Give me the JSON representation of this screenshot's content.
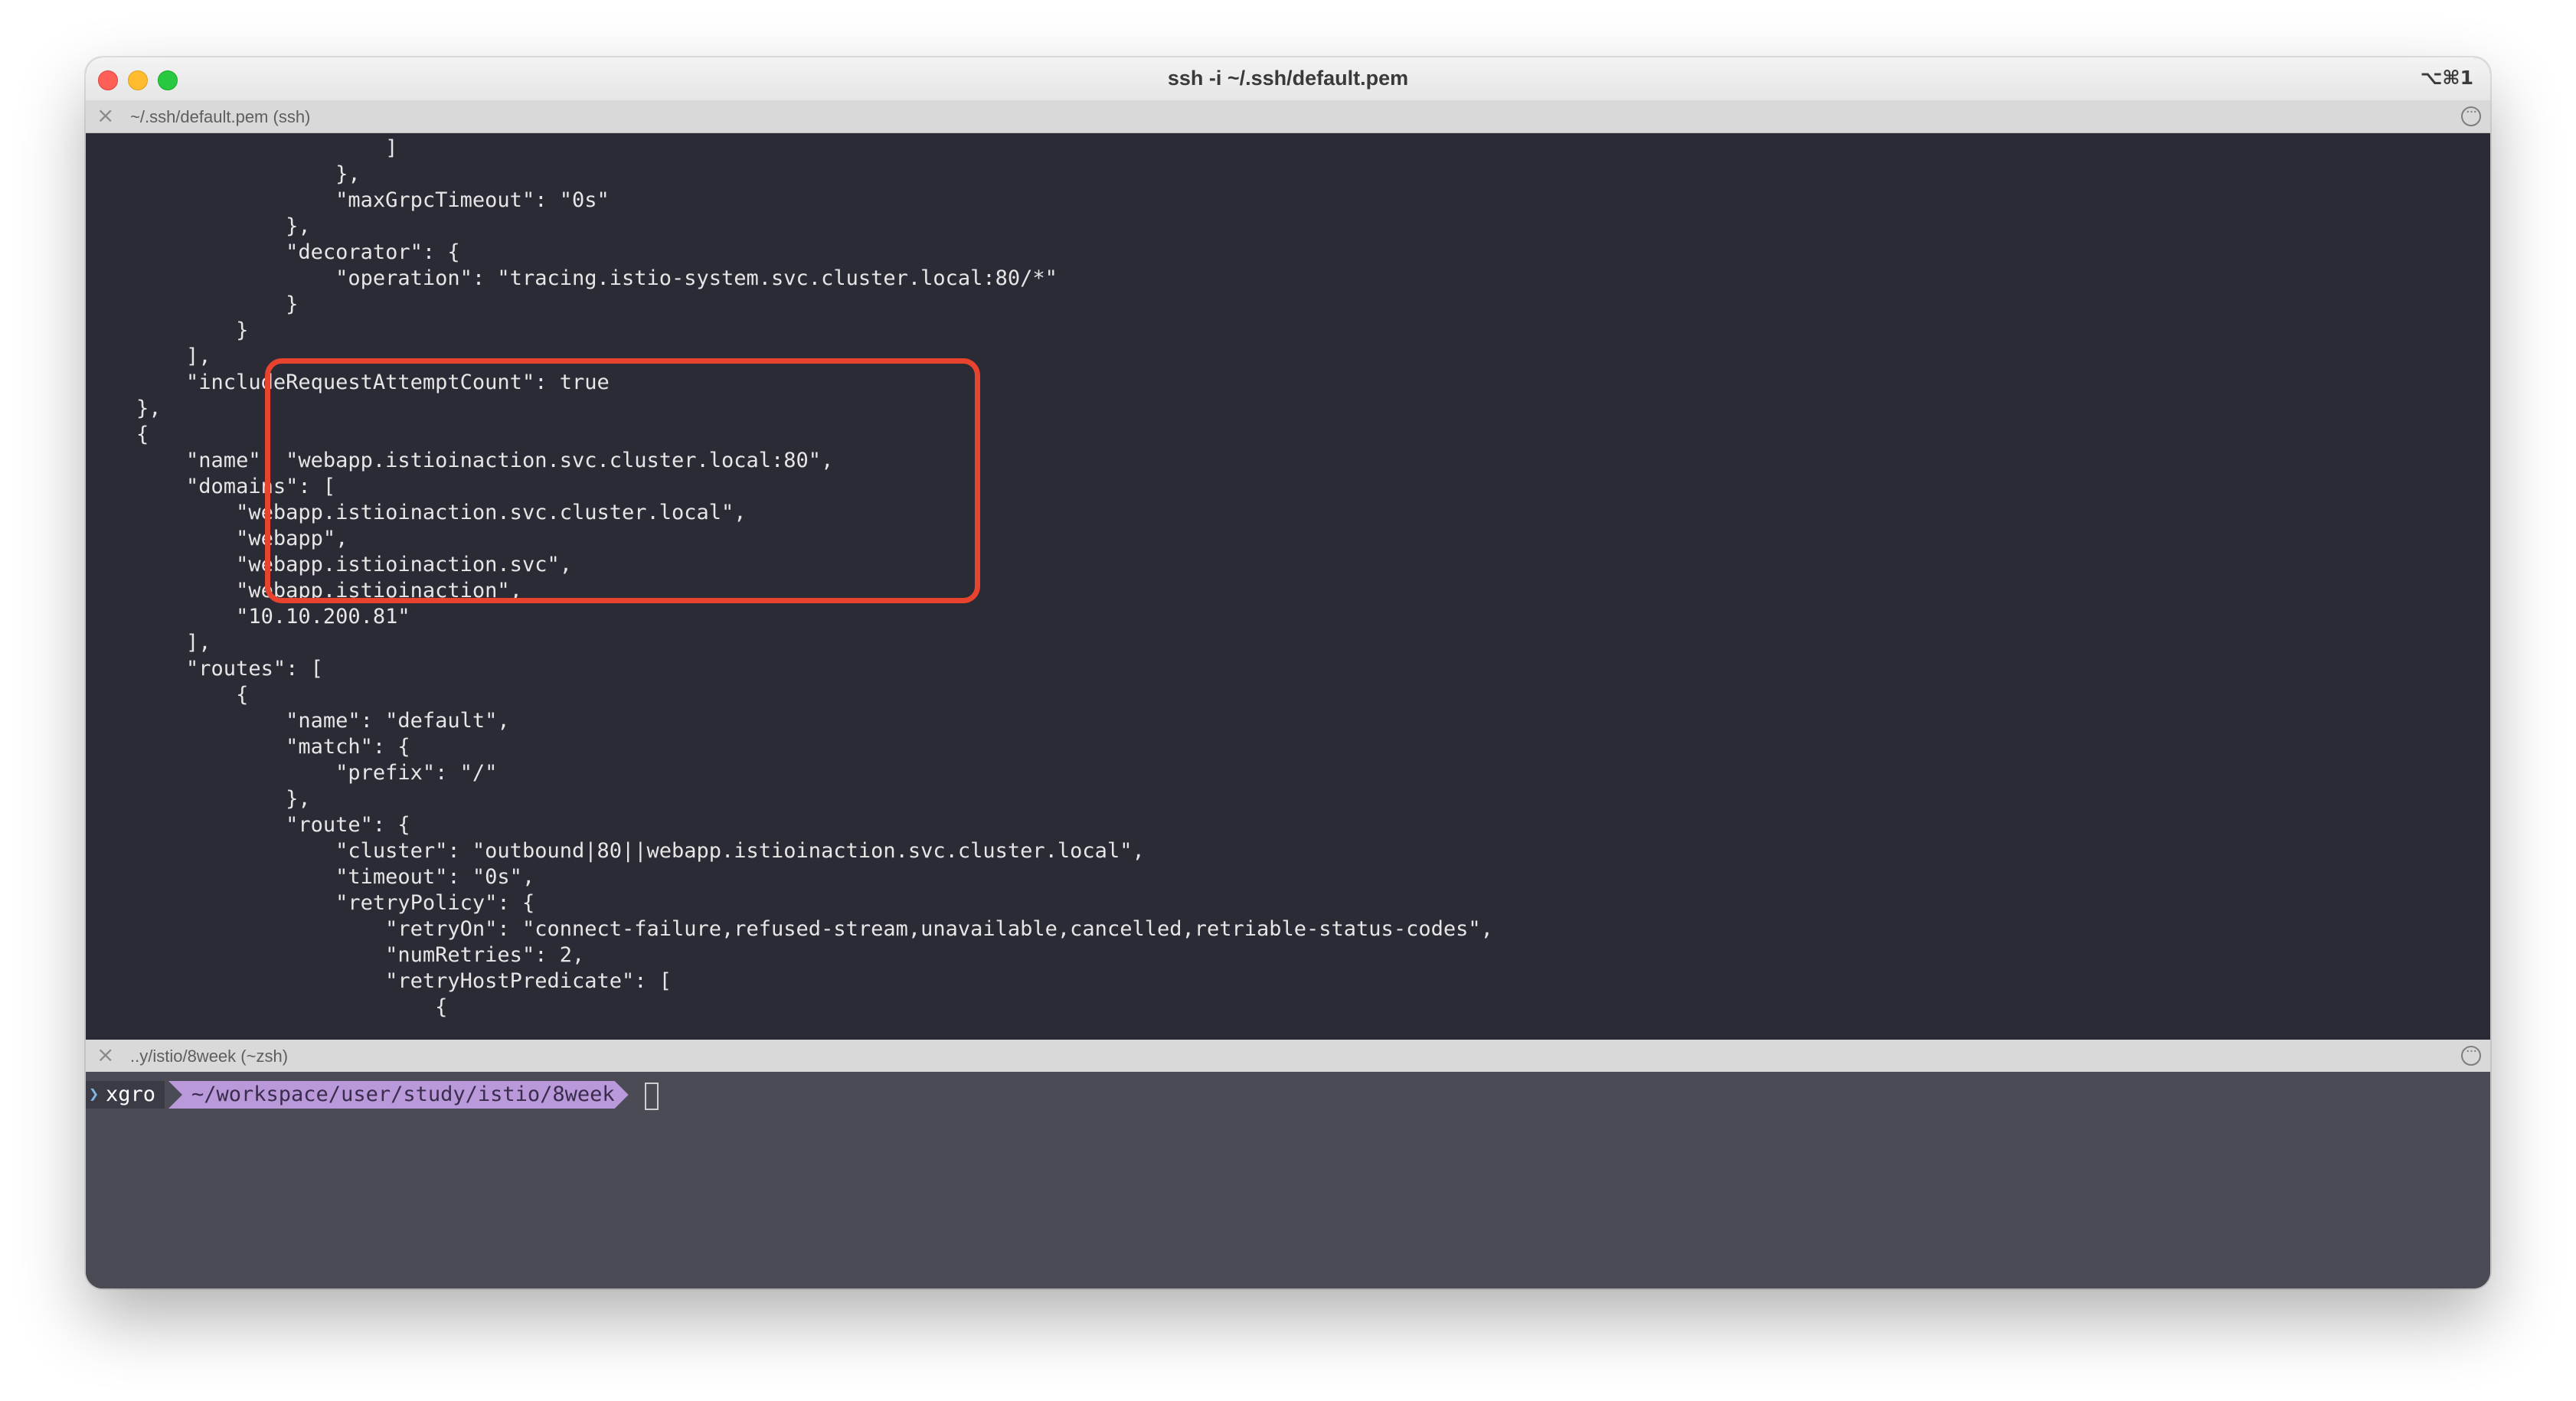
{
  "window": {
    "title": "ssh -i ~/.ssh/default.pem",
    "shortcut": "⌥⌘1"
  },
  "pane_top": {
    "title": "~/.ssh/default.pem (ssh)",
    "lines": [
      "                        ]",
      "                    },",
      "                    \"maxGrpcTimeout\": \"0s\"",
      "                },",
      "                \"decorator\": {",
      "                    \"operation\": \"tracing.istio-system.svc.cluster.local:80/*\"",
      "                }",
      "            }",
      "        ],",
      "        \"includeRequestAttemptCount\": true",
      "    },",
      "    {",
      "        \"name\": \"webapp.istioinaction.svc.cluster.local:80\",",
      "        \"domains\": [",
      "            \"webapp.istioinaction.svc.cluster.local\",",
      "            \"webapp\",",
      "            \"webapp.istioinaction.svc\",",
      "            \"webapp.istioinaction\",",
      "            \"10.10.200.81\"",
      "        ],",
      "        \"routes\": [",
      "            {",
      "                \"name\": \"default\",",
      "                \"match\": {",
      "                    \"prefix\": \"/\"",
      "                },",
      "                \"route\": {",
      "                    \"cluster\": \"outbound|80||webapp.istioinaction.svc.cluster.local\",",
      "                    \"timeout\": \"0s\",",
      "                    \"retryPolicy\": {",
      "                        \"retryOn\": \"connect-failure,refused-stream,unavailable,cancelled,retriable-status-codes\",",
      "                        \"numRetries\": 2,",
      "                        \"retryHostPredicate\": [",
      "                            {"
    ]
  },
  "pane_bottom": {
    "title": "..y/istio/8week (~zsh)",
    "prompt_user": "xgro",
    "prompt_path": "~/workspace/user/study/istio/8week"
  },
  "icons": {
    "close": "close-icon",
    "more": "more-options-icon",
    "prompt_chevron": "chevron-right-icon"
  },
  "colors": {
    "terminal_bg": "#2a2b35",
    "highlight": "#e8432f",
    "prompt_path_bg": "#b999d9"
  }
}
